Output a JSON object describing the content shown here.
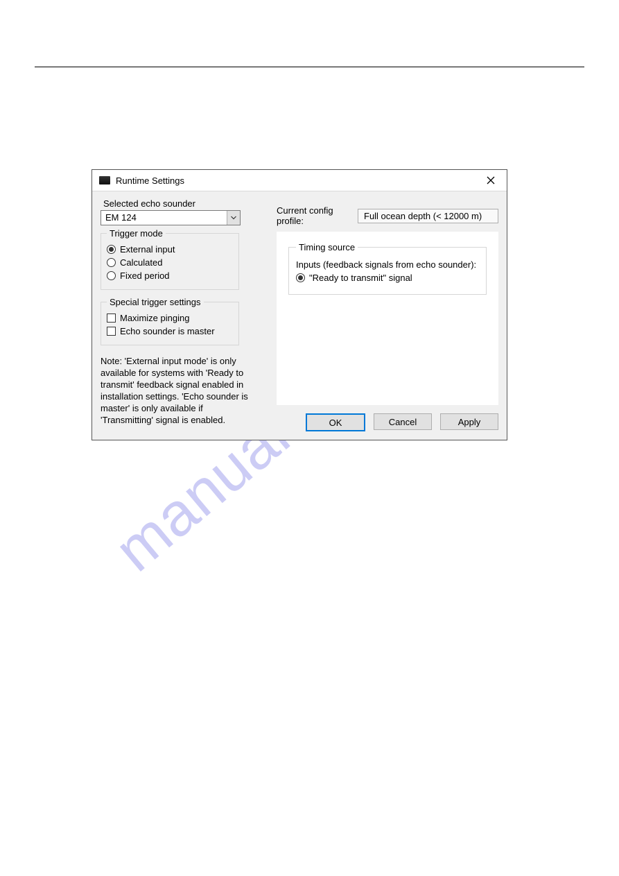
{
  "watermark": "manualshive.com",
  "dialog": {
    "title": "Runtime Settings",
    "left": {
      "selected_label": "Selected echo sounder",
      "selected_value": "EM 124",
      "trigger_mode": {
        "legend": "Trigger mode",
        "options": [
          {
            "label": "External input",
            "checked": true
          },
          {
            "label": "Calculated",
            "checked": false
          },
          {
            "label": "Fixed period",
            "checked": false
          }
        ]
      },
      "special": {
        "legend": "Special trigger settings",
        "options": [
          {
            "label": "Maximize pinging",
            "checked": false
          },
          {
            "label": "Echo sounder is master",
            "checked": false
          }
        ]
      },
      "note": "Note: 'External input mode' is only available for systems with 'Ready to transmit' feedback signal enabled in installation settings.  'Echo sounder is master' is only available if 'Transmitting' signal is enabled."
    },
    "right": {
      "profile_label": "Current config profile:",
      "profile_value": "Full ocean depth (< 12000 m)",
      "timing": {
        "legend": "Timing source",
        "inputs_label": "Inputs (feedback signals from echo sounder):",
        "options": [
          {
            "label": "\"Ready to transmit\" signal",
            "checked": true
          }
        ]
      }
    },
    "buttons": {
      "ok": "OK",
      "cancel": "Cancel",
      "apply": "Apply"
    }
  }
}
